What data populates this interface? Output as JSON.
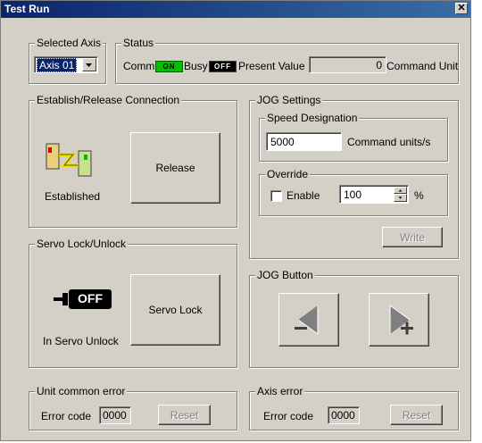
{
  "window": {
    "title": "Test Run"
  },
  "selected_axis": {
    "legend": "Selected Axis",
    "value": "Axis 01"
  },
  "status": {
    "legend": "Status",
    "comm_label": "Comm",
    "comm_indicator": "ON",
    "busy_label": "Busy",
    "busy_indicator": "OFF",
    "present_value_label": "Present Value",
    "present_value": "0",
    "unit_label": "Command Unit"
  },
  "connection": {
    "legend": "Establish/Release Connection",
    "state": "Established",
    "button": "Release"
  },
  "servo": {
    "legend": "Servo Lock/Unlock",
    "icon_text": "OFF",
    "state": "In Servo Unlock",
    "button": "Servo Lock"
  },
  "jog_settings": {
    "legend": "JOG Settings",
    "speed_legend": "Speed Designation",
    "speed_value": "5000",
    "speed_unit": "Command units/s",
    "override_legend": "Override",
    "enable_label": "Enable",
    "override_value": "100",
    "percent": "%",
    "write_button": "Write"
  },
  "jog_button": {
    "legend": "JOG Button"
  },
  "unit_error": {
    "legend": "Unit common error",
    "label": "Error code",
    "value": "0000",
    "reset": "Reset"
  },
  "axis_error": {
    "legend": "Axis error",
    "label": "Error code",
    "value": "0000",
    "reset": "Reset"
  },
  "colors": {
    "on": "#00c000",
    "off": "#000000",
    "title": "#0a246a"
  }
}
